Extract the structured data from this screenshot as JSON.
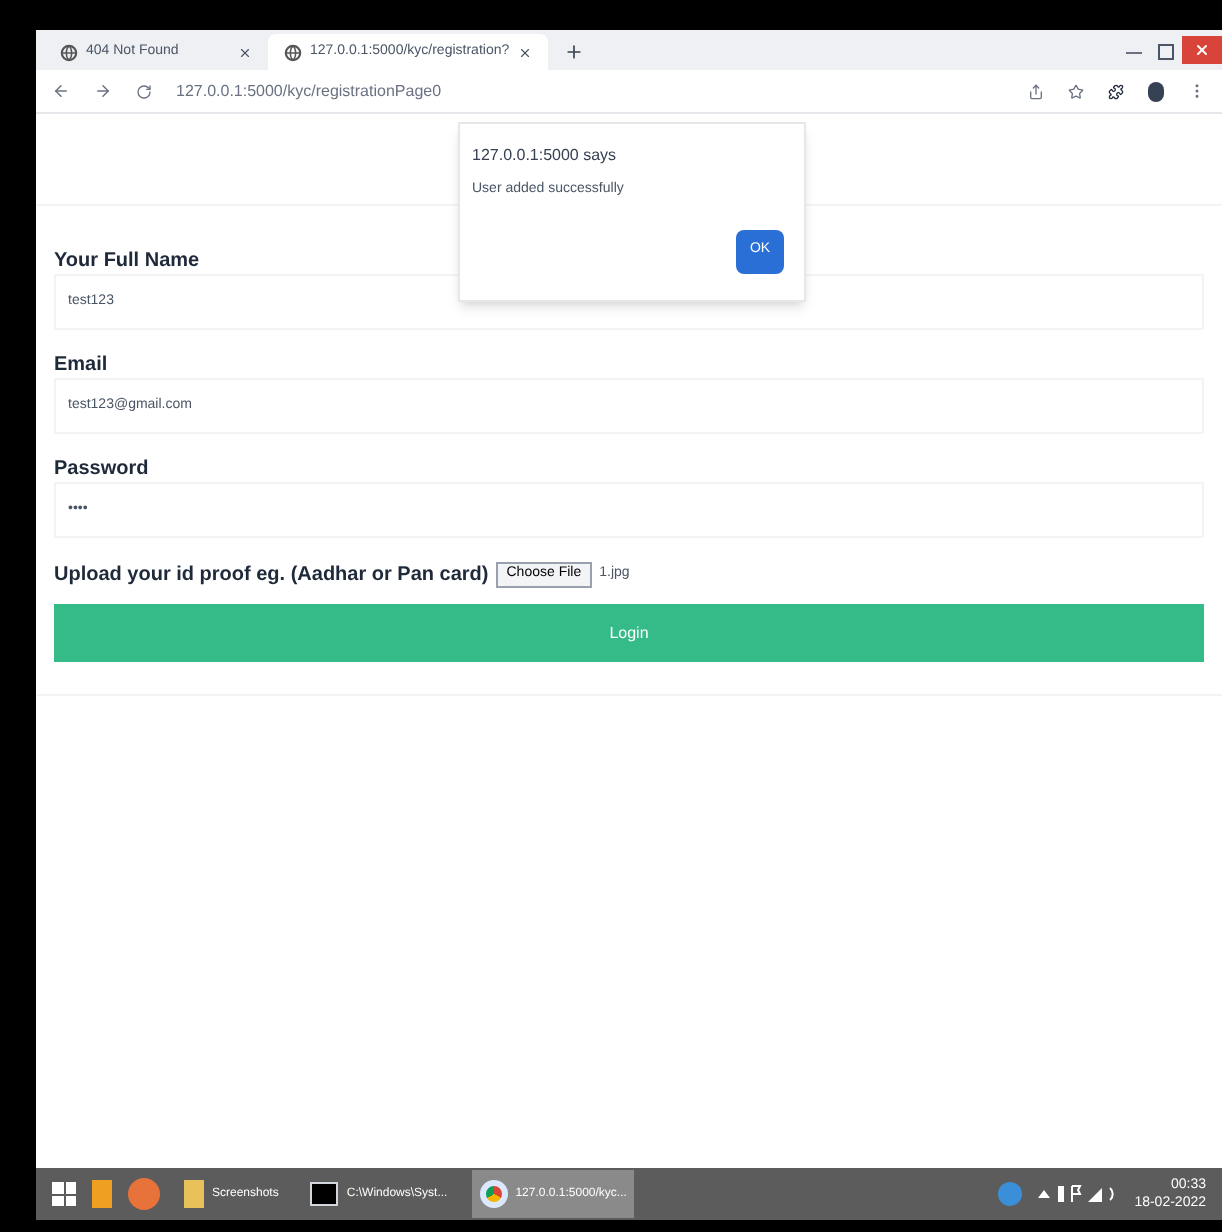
{
  "browser": {
    "tabs": [
      {
        "title": "404 Not Found",
        "selected": false
      },
      {
        "title": "127.0.0.1:5000/kyc/registration?",
        "selected": true
      }
    ],
    "address": "127.0.0.1:5000/kyc/registrationPage0"
  },
  "dialog": {
    "origin": "127.0.0.1:5000 says",
    "message": "User added successfully",
    "button": "OK"
  },
  "form": {
    "fields": [
      {
        "label": "Your Full Name",
        "value": "test123"
      },
      {
        "label": "Email",
        "value": "test123@gmail.com"
      },
      {
        "label": "Password",
        "value": "••••"
      }
    ],
    "upload": {
      "label": "Upload your id proof eg. (Aadhar or Pan card)",
      "button": "Choose File",
      "file": "1.jpg"
    },
    "submit": "Login"
  },
  "taskbar": {
    "windows": [
      {
        "label": "Screenshots",
        "kind": "folder",
        "selected": false
      },
      {
        "label": "C:\\Windows\\Syst...",
        "kind": "console",
        "selected": false
      },
      {
        "label": "127.0.0.1:5000/kyc...",
        "kind": "chrome",
        "selected": true
      }
    ],
    "time": "00:33",
    "date": "18-02-2022"
  }
}
